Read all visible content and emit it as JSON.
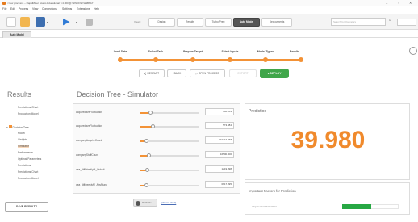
{
  "window": {
    "title": "<new process> – RapidMiner Studio Educational 9.4.000 @ WINDOW-W9B6A7",
    "minimize": "–",
    "maximize": "▫",
    "close": "✕"
  },
  "menu": [
    "File",
    "Edit",
    "Process",
    "View",
    "Connections",
    "Settings",
    "Extensions",
    "Help"
  ],
  "toolbar": {
    "views": [
      "Views:",
      "Design",
      "Results",
      "Turbo Prep",
      "Auto Model",
      "Deployments"
    ],
    "search_placeholder": "Search for Operators",
    "active_view": "Auto Model"
  },
  "tab": {
    "label": "Auto Model"
  },
  "wizard": {
    "steps": [
      "Load Data",
      "Select Task",
      "Prepare Target",
      "Select Inputs",
      "Model Types",
      "Results"
    ],
    "restart": "RESTART",
    "back": "BACK",
    "open_process": "OPEN PROCESS",
    "export": "EXPORT",
    "deploy": "DEPLOY"
  },
  "results": {
    "title": "Results",
    "items": [
      {
        "label": "Predictions Chart",
        "indent": 1
      },
      {
        "label": "Production Model",
        "indent": 1
      },
      {
        "label": "Decision Tree",
        "indent": 0
      },
      {
        "label": "Model",
        "indent": 1
      },
      {
        "label": "Weights",
        "indent": 1
      },
      {
        "label": "Simulator",
        "indent": 1
      },
      {
        "label": "Performance",
        "indent": 1
      },
      {
        "label": "Optimal Parameters",
        "indent": 1
      },
      {
        "label": "Predictions",
        "indent": 1
      },
      {
        "label": "Predictions Chart",
        "indent": 1
      },
      {
        "label": "Production Model",
        "indent": 1
      }
    ],
    "save_button": "SAVE RESULTS"
  },
  "simulator": {
    "title": "Decision Tree - Simulator",
    "rows": [
      {
        "label": "acquiredaveFluctuation",
        "value": "600.283",
        "fraction": 0.18
      },
      {
        "label": "acquiredaveFluctuation",
        "value": "573.084",
        "fraction": 0.22
      },
      {
        "label": "companyAcquireCount",
        "value": "210413.068",
        "fraction": 0.1
      },
      {
        "label": "companyStaffCount",
        "value": "16500.000",
        "fraction": 0.15
      },
      {
        "label": "dea_diffWeeklyM_Velocit",
        "value": "1219.898",
        "fraction": 0.12
      },
      {
        "label": "dea_diffweeklyM_AbsFlunc",
        "value": "0617.395",
        "fraction": 0.1
      }
    ],
    "optimize": "Optimize",
    "whats_this": "(What's this?)"
  },
  "prediction": {
    "label": "Prediction",
    "value": "39.980"
  },
  "factors": {
    "title": "Important Factors for Prediction",
    "top_label": "acquiredaveFluctuation",
    "top_fraction": 0.52
  },
  "colors": {
    "accent_orange": "#f39236",
    "prediction": "#f08a2c",
    "deploy_green": "#40a64a",
    "factor_green": "#27a844"
  }
}
